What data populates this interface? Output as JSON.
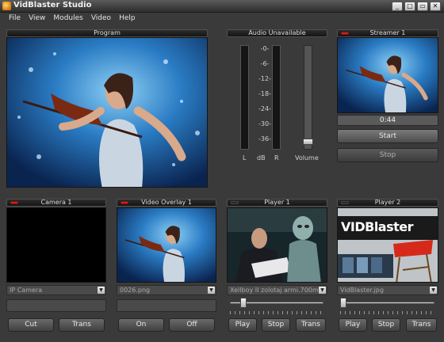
{
  "window": {
    "title": "VidBlaster Studio",
    "buttons": [
      "_",
      "□",
      "▭",
      "✕"
    ]
  },
  "menu": [
    "File",
    "View",
    "Modules",
    "Video",
    "Help"
  ],
  "program": {
    "title": "Program"
  },
  "audio": {
    "title": "Audio Unavailable",
    "db_marks": [
      "-0-",
      "-6-",
      "-12-",
      "-18-",
      "-24-",
      "-30-",
      "-36-"
    ],
    "left_label": "L",
    "db_label": "dB",
    "right_label": "R",
    "volume_label": "Volume",
    "volume_level": 0.04
  },
  "streamer": {
    "title": "Streamer 1",
    "time": "0:44",
    "start_label": "Start",
    "stop_label": "Stop"
  },
  "camera": {
    "title": "Camera 1",
    "source": "IP Camera",
    "cut_label": "Cut",
    "trans_label": "Trans"
  },
  "overlay": {
    "title": "Video Overlay 1",
    "file": "0026.png",
    "on_label": "On",
    "off_label": "Off"
  },
  "player1": {
    "title": "Player 1",
    "file": "Xellboy II zolotaj armi.700mg",
    "position": 0.12,
    "play_label": "Play",
    "stop_label": "Stop",
    "trans_label": "Trans"
  },
  "player2": {
    "title": "Player 2",
    "file": "VidBlaster.jpg",
    "position": 0.0,
    "logo_text": "VIDBlaster",
    "play_label": "Play",
    "stop_label": "Stop",
    "trans_label": "Trans"
  },
  "colors": {
    "accent_red": "#d02020",
    "panel_bg": "#3a3a3a",
    "video_blue": "#1a4f8c"
  }
}
